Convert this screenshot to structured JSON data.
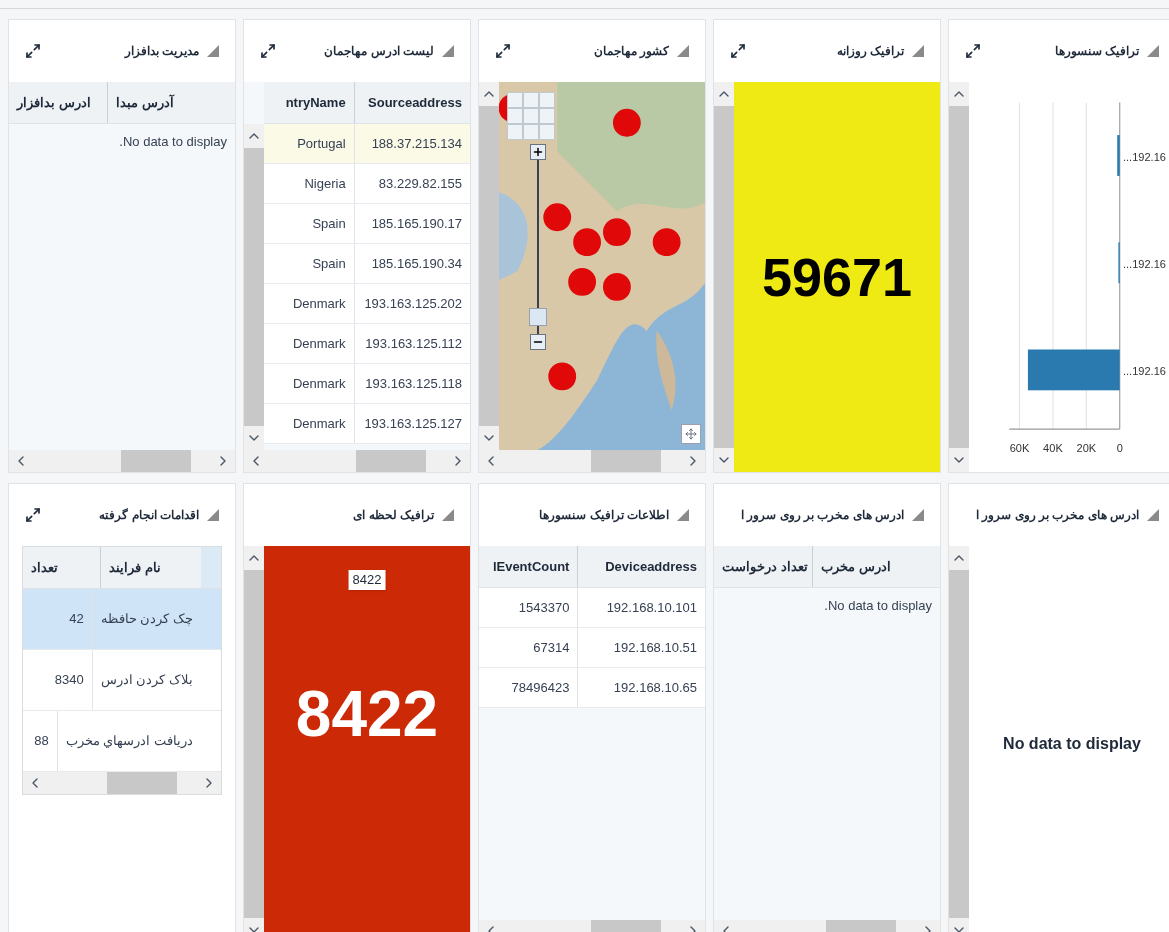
{
  "panels": [
    {
      "kind": "bar_chart",
      "title": "ترافیک سنسورها",
      "expand_icon": true,
      "chart_data": {
        "type": "bar",
        "orientation": "horizontal",
        "grid": true,
        "categories": [
          "...192.16",
          "...192.16",
          "...192.16"
        ],
        "values": [
          1500,
          800,
          55000
        ],
        "xlim": [
          65000,
          0
        ],
        "xticks": [
          {
            "value": 60000,
            "label": "60K"
          },
          {
            "value": 40000,
            "label": "40K"
          },
          {
            "value": 20000,
            "label": "20K"
          },
          {
            "value": 0,
            "label": "0"
          }
        ]
      }
    },
    {
      "kind": "metric",
      "title": "ترافیک روزانه",
      "expand_icon": true,
      "value": "59671",
      "color": "#f0ea14"
    },
    {
      "kind": "map",
      "title": "کشور مهاجمان",
      "expand_icon": true
    },
    {
      "kind": "table",
      "title": "لیست ادرس مهاجمان",
      "expand_icon": true,
      "vscroll": true,
      "framed": false,
      "columns": [
        "Sourceaddress",
        "ntryName"
      ],
      "rows": [
        {
          "cells": [
            "188.37.215.134",
            "Portugal"
          ],
          "selected": true
        },
        {
          "cells": [
            "83.229.82.155",
            "Nigeria"
          ],
          "selected": false
        },
        {
          "cells": [
            "185.165.190.17",
            "Spain"
          ],
          "selected": false
        },
        {
          "cells": [
            "185.165.190.34",
            "Spain"
          ],
          "selected": false
        },
        {
          "cells": [
            "193.163.125.202",
            "Denmark"
          ],
          "selected": false
        },
        {
          "cells": [
            "193.163.125.112",
            "Denmark"
          ],
          "selected": false
        },
        {
          "cells": [
            "193.163.125.118",
            "Denmark"
          ],
          "selected": false
        },
        {
          "cells": [
            "193.163.125.127",
            "Denmark"
          ],
          "selected": false
        }
      ]
    },
    {
      "kind": "table",
      "title": "مدیریت بدافزار",
      "expand_icon": true,
      "vscroll": false,
      "framed": false,
      "columns": [
        "آدرس مبدا",
        "ادرس بدافزار"
      ],
      "empty_message": ".No data to display"
    },
    {
      "kind": "empty",
      "title": "ادرس های مخرب بر روی سرور ا",
      "expand_icon": false,
      "message": "No data to display"
    },
    {
      "kind": "table",
      "title": "ادرس های مخرب بر روی سرور ا",
      "expand_icon": false,
      "vscroll": false,
      "framed": false,
      "columns": [
        "ادرس مخرب",
        "تعداد درخواست"
      ],
      "empty_message": ".No data to display"
    },
    {
      "kind": "table",
      "title": "اطلاعات ترافیک سنسورها",
      "expand_icon": false,
      "vscroll": false,
      "framed": false,
      "columns": [
        "Deviceaddress",
        "lEventCount"
      ],
      "rows": [
        {
          "cells": [
            "192.168.10.101",
            "1543370"
          ],
          "selected": false
        },
        {
          "cells": [
            "192.168.10.51",
            "67314"
          ],
          "selected": false
        },
        {
          "cells": [
            "192.168.10.65",
            "78496423"
          ],
          "selected": false
        }
      ]
    },
    {
      "kind": "metric",
      "title": "ترافیک لحظه ای",
      "expand_icon": false,
      "value": "8422",
      "color": "#cc2a06",
      "tooltip": "8422"
    },
    {
      "kind": "table",
      "title": "اقدامات انجام گرفته",
      "expand_icon": true,
      "vscroll": false,
      "framed": true,
      "columns": [
        "نام فرایند",
        "تعداد"
      ],
      "rows": [
        {
          "cells": [
            "چک کردن حافظه",
            "42"
          ],
          "selected": true
        },
        {
          "cells": [
            "بلاک کردن ادرس",
            "8340"
          ],
          "selected": false
        },
        {
          "cells": [
            "دریافت ادرسهاي مخرب",
            "88"
          ],
          "selected": false
        }
      ]
    }
  ]
}
